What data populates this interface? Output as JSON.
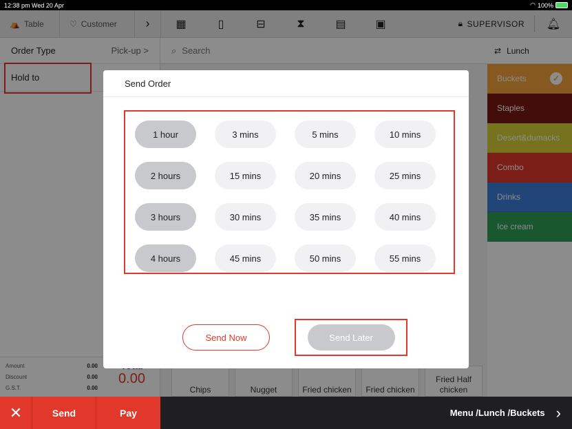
{
  "status_bar": {
    "time_date": "12:38 pm  Wed 20 Apr",
    "battery": "100%"
  },
  "toolbar": {
    "table_label": "Table",
    "customer_label": "Customer",
    "supervisor_label": "SUPERVISOR",
    "icons": [
      "calendar-icon",
      "tablet-icon",
      "drawer-icon",
      "hourglass-icon",
      "clipboard-icon",
      "id-card-icon"
    ]
  },
  "left_panel": {
    "order_type_label": "Order Type",
    "order_type_value": "Pick-up >",
    "hold_to_label": "Hold to",
    "totals": [
      {
        "label": "Amount",
        "value": "0.00"
      },
      {
        "label": "Discount",
        "value": "0.00"
      },
      {
        "label": "G.S.T.",
        "value": "0.00"
      }
    ],
    "total_label": "Total",
    "total_value": "0.00"
  },
  "search": {
    "placeholder": "Search"
  },
  "products": [
    "Chips",
    "Nugget",
    "Fried chicken",
    "Fried chicken",
    "Fried Half chicken"
  ],
  "categories": {
    "header": "Lunch",
    "items": [
      {
        "label": "Buckets",
        "color": "#f2a33a",
        "selected": true
      },
      {
        "label": "Staples",
        "color": "#7a1a12",
        "selected": false
      },
      {
        "label": "Desert&dumacks",
        "color": "#d8cf35",
        "selected": false
      },
      {
        "label": "Combo",
        "color": "#e2382c",
        "selected": false
      },
      {
        "label": "Drinks",
        "color": "#3f7fd9",
        "selected": false
      },
      {
        "label": "Ice cream",
        "color": "#2f9f57",
        "selected": false
      }
    ]
  },
  "bottom_bar": {
    "send_label": "Send",
    "pay_label": "Pay",
    "breadcrumb": "Menu /Lunch /Buckets"
  },
  "modal": {
    "title": "Send Order",
    "time_options": [
      [
        "1 hour",
        "3 mins",
        "5 mins",
        "10 mins"
      ],
      [
        "2 hours",
        "15 mins",
        "20 mins",
        "25 mins"
      ],
      [
        "3 hours",
        "30 mins",
        "35 mins",
        "40 mins"
      ],
      [
        "4 hours",
        "45 mins",
        "50 mins",
        "55 mins"
      ]
    ],
    "send_now_label": "Send Now",
    "send_later_label": "Send Later"
  },
  "colors": {
    "accent": "#e2382c",
    "pill_dark": "#c8c9cd",
    "pill_light": "#f1f1f3"
  }
}
